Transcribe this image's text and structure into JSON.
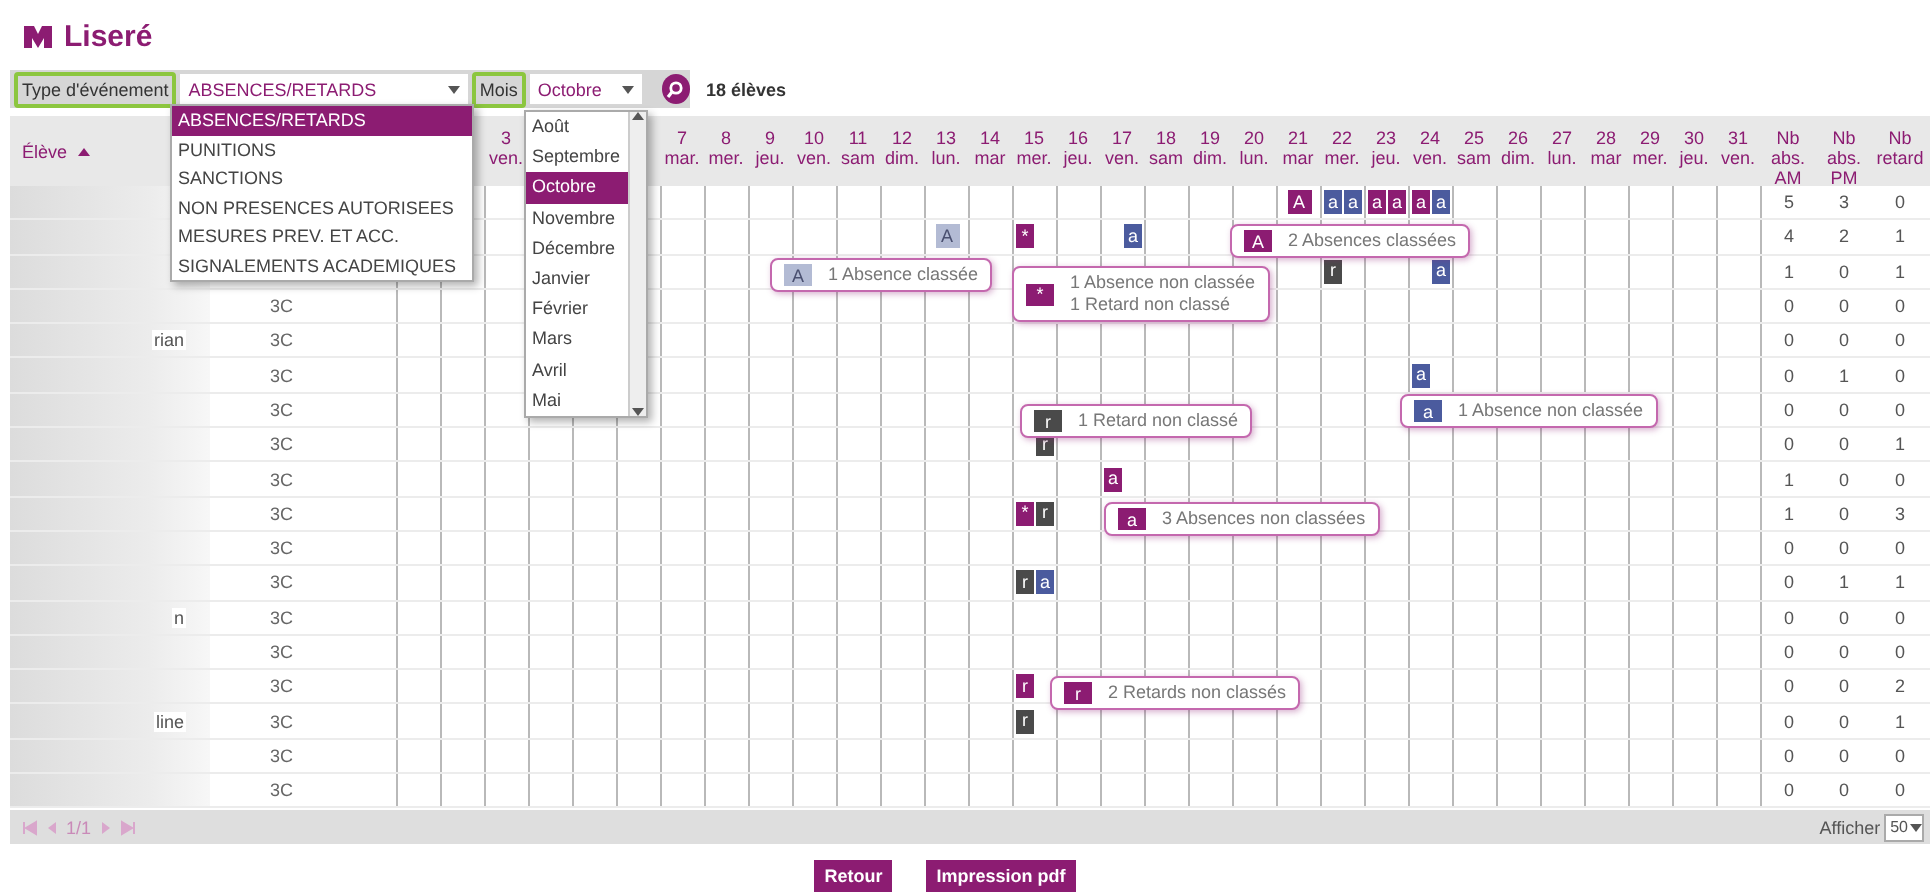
{
  "title": "Liseré",
  "filters": {
    "event_type": {
      "label": "Type d'événement",
      "highlighted": true,
      "value": "ABSENCES/RETARDS",
      "options": [
        {
          "label": "ABSENCES/RETARDS",
          "selected": true
        },
        {
          "label": "PUNITIONS",
          "selected": false
        },
        {
          "label": "SANCTIONS",
          "selected": false
        },
        {
          "label": "NON PRESENCES AUTORISEES",
          "selected": false
        },
        {
          "label": "MESURES PREV. ET ACC.",
          "selected": false
        },
        {
          "label": "SIGNALEMENTS ACADEMIQUES",
          "selected": false
        }
      ]
    },
    "month": {
      "label": "Mois",
      "highlighted": true,
      "value": "Octobre",
      "options": [
        {
          "label": "Août",
          "selected": false
        },
        {
          "label": "Septembre",
          "selected": false
        },
        {
          "label": "Octobre",
          "selected": true
        },
        {
          "label": "Novembre",
          "selected": false
        },
        {
          "label": "Décembre",
          "selected": false
        },
        {
          "label": "Janvier",
          "selected": false
        },
        {
          "label": "Février",
          "selected": false
        },
        {
          "label": "Mars",
          "selected": false
        },
        {
          "label": "Avril",
          "selected": false
        },
        {
          "label": "Mai",
          "selected": false
        }
      ]
    },
    "count": "18 élèves"
  },
  "table": {
    "columns": {
      "student": {
        "label": "Élève",
        "sorted": true
      },
      "days": [
        {
          "date": "3",
          "weekday": "ven."
        },
        {
          "date": "7",
          "weekday": "mar."
        },
        {
          "date": "8",
          "weekday": "mer."
        },
        {
          "date": "9",
          "weekday": "jeu."
        },
        {
          "date": "10",
          "weekday": "ven."
        },
        {
          "date": "11",
          "weekday": "sam"
        },
        {
          "date": "12",
          "weekday": "dim."
        },
        {
          "date": "13",
          "weekday": "lun."
        },
        {
          "date": "14",
          "weekday": "mar"
        },
        {
          "date": "15",
          "weekday": "mer."
        },
        {
          "date": "16",
          "weekday": "jeu."
        },
        {
          "date": "17",
          "weekday": "ven."
        },
        {
          "date": "18",
          "weekday": "sam"
        },
        {
          "date": "19",
          "weekday": "dim."
        },
        {
          "date": "20",
          "weekday": "lun."
        },
        {
          "date": "21",
          "weekday": "mar"
        },
        {
          "date": "22",
          "weekday": "mer."
        },
        {
          "date": "23",
          "weekday": "jeu."
        },
        {
          "date": "24",
          "weekday": "ven."
        },
        {
          "date": "25",
          "weekday": "sam"
        },
        {
          "date": "26",
          "weekday": "dim."
        },
        {
          "date": "27",
          "weekday": "lun."
        },
        {
          "date": "28",
          "weekday": "mar"
        },
        {
          "date": "29",
          "weekday": "mer."
        },
        {
          "date": "30",
          "weekday": "jeu."
        },
        {
          "date": "31",
          "weekday": "ven."
        }
      ],
      "totals": [
        "Nb\nabs.\nAM",
        "Nb\nabs.\nPM",
        "Nb\nretard"
      ]
    },
    "rows": [
      {
        "events": [
          {
            "label": "A",
            "color": "#8c1c72"
          },
          {
            "label": "a",
            "color": "#4b5b9e"
          },
          {
            "label": "a",
            "color": "#4b5b9e"
          },
          {
            "label": "a",
            "color": "#8c1c72"
          },
          {
            "label": "a",
            "color": "#8c1c72"
          },
          {
            "label": "a",
            "color": "#8c1c72"
          },
          {
            "label": "a",
            "color": "#4b5b9e"
          }
        ],
        "totals": [
          "5",
          "3",
          "0"
        ]
      },
      {
        "events": [
          {
            "label": "A",
            "color": "#b3bbd4"
          },
          {
            "label": "*",
            "color": "#8c1c72"
          },
          {
            "label": "a",
            "color": "#4b5b9e"
          }
        ],
        "totals": [
          "4",
          "2",
          "1"
        ]
      },
      {
        "events": [
          {
            "label": "r",
            "color": "#4a4a4a"
          },
          {
            "label": "a",
            "color": "#4b5b9e"
          }
        ],
        "totals": [
          "1",
          "0",
          "1"
        ]
      },
      {
        "class": "3C",
        "totals": [
          "0",
          "0",
          "0"
        ]
      },
      {
        "name": "rian",
        "class": "3C",
        "totals": [
          "0",
          "0",
          "0"
        ]
      },
      {
        "class": "3C",
        "events": [
          {
            "label": "a",
            "color": "#4b5b9e"
          }
        ],
        "totals": [
          "0",
          "1",
          "0"
        ]
      },
      {
        "class": "3C",
        "totals": [
          "0",
          "0",
          "0"
        ]
      },
      {
        "class": "3C",
        "events": [
          {
            "label": "r",
            "color": "#4a4a4a"
          }
        ],
        "totals": [
          "0",
          "0",
          "1"
        ]
      },
      {
        "class": "3C",
        "events": [
          {
            "label": "a",
            "color": "#8c1c72"
          }
        ],
        "totals": [
          "1",
          "0",
          "0"
        ]
      },
      {
        "class": "3C",
        "events": [
          {
            "label": "*",
            "color": "#8c1c72"
          },
          {
            "label": "r",
            "color": "#4a4a4a"
          }
        ],
        "totals": [
          "1",
          "0",
          "3"
        ]
      },
      {
        "class": "3C",
        "totals": [
          "0",
          "0",
          "0"
        ]
      },
      {
        "class": "3C",
        "events": [
          {
            "label": "r",
            "color": "#4a4a4a"
          },
          {
            "label": "a",
            "color": "#4b5b9e"
          }
        ],
        "totals": [
          "0",
          "1",
          "1"
        ]
      },
      {
        "name": "n",
        "class": "3C",
        "totals": [
          "0",
          "0",
          "0"
        ]
      },
      {
        "class": "3C",
        "totals": [
          "0",
          "0",
          "0"
        ]
      },
      {
        "class": "3C",
        "events": [
          {
            "label": "r",
            "color": "#8c1c72"
          }
        ],
        "totals": [
          "0",
          "0",
          "2"
        ]
      },
      {
        "name": "line",
        "class": "3C",
        "events": [
          {
            "label": "r",
            "color": "#4a4a4a"
          }
        ],
        "totals": [
          "0",
          "0",
          "1"
        ]
      },
      {
        "class": "3C",
        "totals": [
          "0",
          "0",
          "0"
        ]
      },
      {
        "class": "3C",
        "totals": [
          "0",
          "0",
          "0"
        ]
      }
    ]
  },
  "popups": [
    {
      "icon": "A",
      "color": "#8c1c72",
      "lines": [
        "2 Absences classées"
      ]
    },
    {
      "icon": "A",
      "color": "#b3bbd4",
      "lines": [
        "1 Absence classée"
      ]
    },
    {
      "icon": "*",
      "color": "#8c1c72",
      "lines": [
        "1 Absence non classée",
        "1 Retard non classé"
      ]
    },
    {
      "icon": "a",
      "color": "#4b5b9e",
      "lines": [
        "1 Absence non classée"
      ]
    },
    {
      "icon": "r",
      "color": "#4a4a4a",
      "lines": [
        "1 Retard non classé"
      ]
    },
    {
      "icon": "a",
      "color": "#8c1c72",
      "lines": [
        "3 Absences non classées"
      ]
    },
    {
      "icon": "r",
      "color": "#8c1c72",
      "lines": [
        "2 Retards non classés"
      ]
    }
  ],
  "pager": {
    "page": "1/1",
    "show_label": "Afficher",
    "page_size": "50"
  },
  "buttons": [
    "Retour",
    "Impression pdf"
  ]
}
